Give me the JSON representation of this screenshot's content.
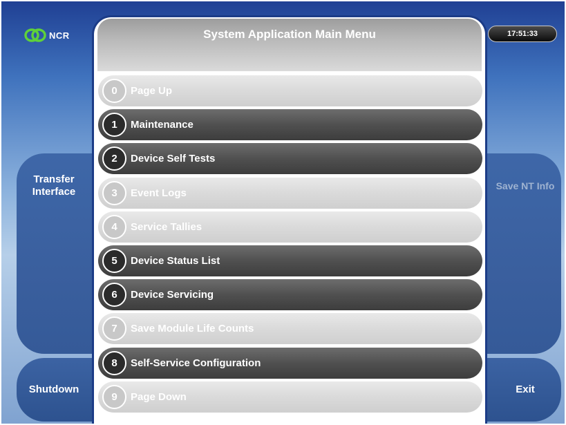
{
  "brand": {
    "logo_text": "NCR"
  },
  "clock": "17:51:33",
  "title": "System Application Main Menu",
  "side": {
    "left_top": [
      "Transfer",
      "Interface"
    ],
    "right_top": "Save NT Info",
    "left_bottom": "Shutdown",
    "right_bottom": "Exit"
  },
  "menu": [
    {
      "num": "0",
      "label": "Page Up",
      "state": "disabled"
    },
    {
      "num": "1",
      "label": "Maintenance",
      "state": "active"
    },
    {
      "num": "2",
      "label": "Device Self Tests",
      "state": "active"
    },
    {
      "num": "3",
      "label": "Event Logs",
      "state": "disabled"
    },
    {
      "num": "4",
      "label": "Service Tallies",
      "state": "disabled"
    },
    {
      "num": "5",
      "label": "Device Status List",
      "state": "active"
    },
    {
      "num": "6",
      "label": "Device Servicing",
      "state": "active"
    },
    {
      "num": "7",
      "label": "Save Module Life Counts",
      "state": "disabled"
    },
    {
      "num": "8",
      "label": "Self-Service Configuration",
      "state": "active"
    },
    {
      "num": "9",
      "label": "Page Down",
      "state": "disabled"
    }
  ],
  "colors": {
    "accent": "#1c3c87",
    "active_item": "#505050",
    "disabled_item": "#dadada"
  }
}
